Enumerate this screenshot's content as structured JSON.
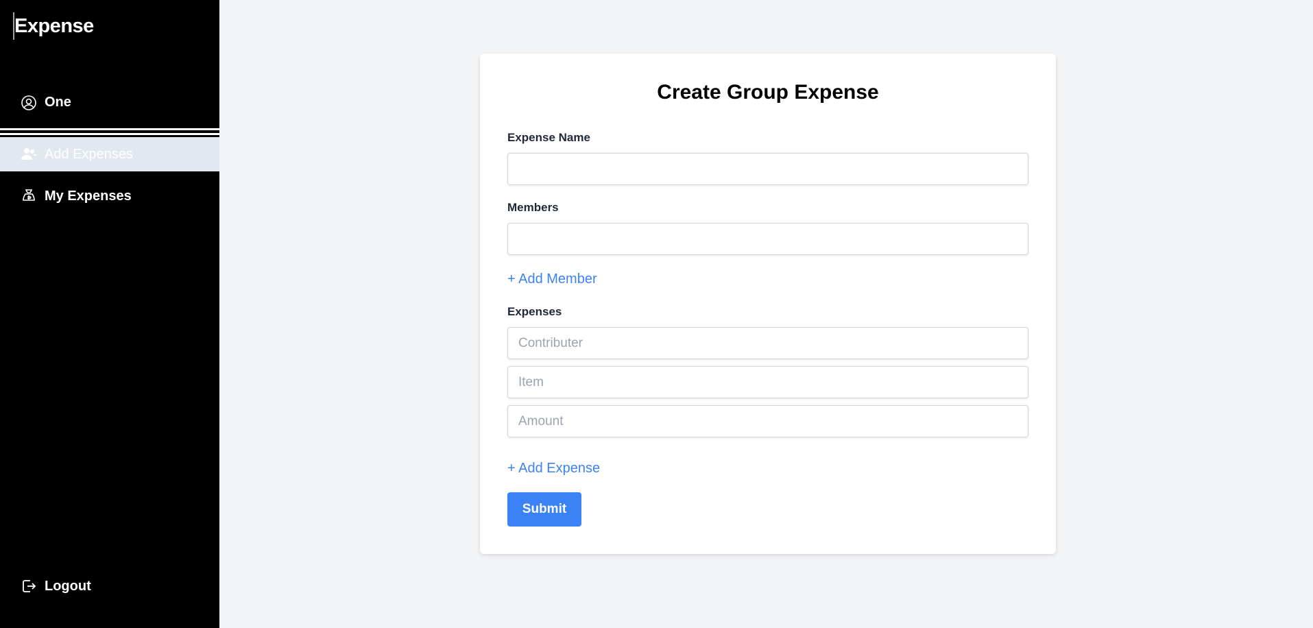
{
  "sidebar": {
    "brand": "Expense",
    "user_name": "One",
    "items": [
      {
        "label": "Add Expenses",
        "icon": "users-icon"
      },
      {
        "label": "My Expenses",
        "icon": "money-bag-icon"
      }
    ],
    "logout_label": "Logout"
  },
  "form": {
    "title": "Create Group Expense",
    "expense_name_label": "Expense Name",
    "expense_name_value": "",
    "members_label": "Members",
    "members_value": "",
    "add_member_label": "+ Add Member",
    "expenses_label": "Expenses",
    "contributer_placeholder": "Contributer",
    "item_placeholder": "Item",
    "amount_placeholder": "Amount",
    "add_expense_label": "+ Add Expense",
    "submit_label": "Submit"
  },
  "colors": {
    "accent": "#3b82f6",
    "sidebar_bg": "#000000",
    "active_item_bg": "#e2e8f0",
    "page_bg": "#f3f4f6"
  }
}
